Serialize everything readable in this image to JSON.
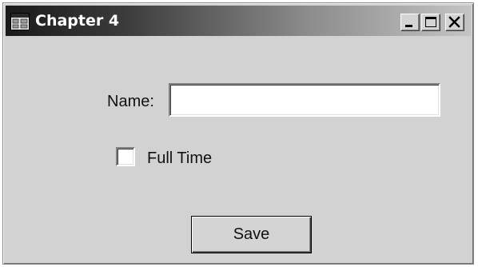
{
  "window": {
    "title": "Chapter 4",
    "icon": "app-window-icon",
    "controls": {
      "minimize": "minimize-icon",
      "maximize": "maximize-icon",
      "close": "close-icon"
    }
  },
  "form": {
    "name_label": "Name:",
    "name_value": "",
    "fulltime_label": "Full Time",
    "fulltime_checked": false,
    "save_label": "Save"
  }
}
